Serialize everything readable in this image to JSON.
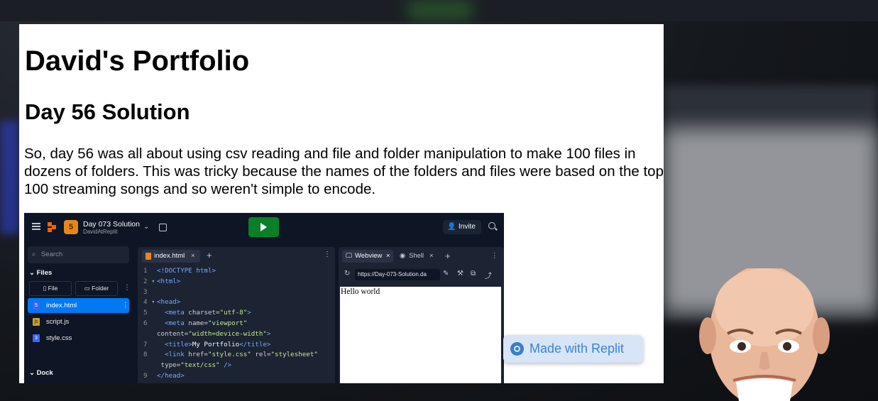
{
  "page": {
    "title": "David's Portfolio",
    "subtitle": "Day 56 Solution",
    "paragraph": "So, day 56 was all about using csv reading and file and folder manipulation to make 100 files in dozens of folders. This was tricky because the names of the folders and files were based on the top 100 streaming songs and so weren't simple to encode."
  },
  "replit": {
    "project_title": "Day 073 Solution",
    "project_owner": "DavidAtReplit",
    "invite_label": "Invite",
    "search_placeholder": "Search",
    "files_heading": "Files",
    "file_button": "File",
    "folder_button": "Folder",
    "files": [
      {
        "name": "index.html",
        "icon": "html-file-icon",
        "active": true
      },
      {
        "name": "script.js",
        "icon": "js-file-icon",
        "active": false
      },
      {
        "name": "style.css",
        "icon": "css-file-icon",
        "active": false
      }
    ],
    "dock_label": "Dock",
    "editor_tab": "index.html",
    "code_lines": [
      {
        "n": "1",
        "html": "<span class='tagc'>&lt;!DOCTYPE html&gt;</span>"
      },
      {
        "n": "2",
        "html": "<span class='tagc'>&lt;html&gt;</span>"
      },
      {
        "n": "3",
        "html": ""
      },
      {
        "n": "4",
        "html": "<span class='tagc'>&lt;head&gt;</span>"
      },
      {
        "n": "5",
        "html": "  <span class='tagc'>&lt;meta</span> <span class='attr'>charset=</span><span class='str'>\"utf-8\"</span><span class='tagc'>&gt;</span>"
      },
      {
        "n": "6",
        "html": "  <span class='tagc'>&lt;meta</span> <span class='attr'>name=</span><span class='str'>\"viewport\"</span>"
      },
      {
        "n": "",
        "html": "<span class='attr'>content=</span><span class='str'>\"width=device-width\"</span><span class='tagc'>&gt;</span>"
      },
      {
        "n": "7",
        "html": "  <span class='tagc'>&lt;title&gt;</span><span class='txt'>My Portfolio</span><span class='tagc'>&lt;/title&gt;</span>"
      },
      {
        "n": "8",
        "html": "  <span class='tagc'>&lt;link</span> <span class='attr'>href=</span><span class='str'>\"style.css\"</span> <span class='attr'>rel=</span><span class='str'>\"stylesheet\"</span>"
      },
      {
        "n": "",
        "html": " <span class='attr'>type=</span><span class='str'>\"text/css\"</span> <span class='tagc'>/&gt;</span>"
      },
      {
        "n": "9",
        "html": "<span class='tagc'>&lt;/head&gt;</span>"
      }
    ],
    "webview_tab": "Webview",
    "shell_tab": "Shell",
    "url": "https://Day-073-Solution.da",
    "webview_text": "Hello world"
  },
  "badge": {
    "label": "Made with Replit"
  },
  "colors": {
    "accent": "#0079f2",
    "run": "#0a7f29",
    "replit_orange": "#f26207",
    "badge_bg": "#d7e5f7",
    "badge_text": "#3f82d0"
  }
}
